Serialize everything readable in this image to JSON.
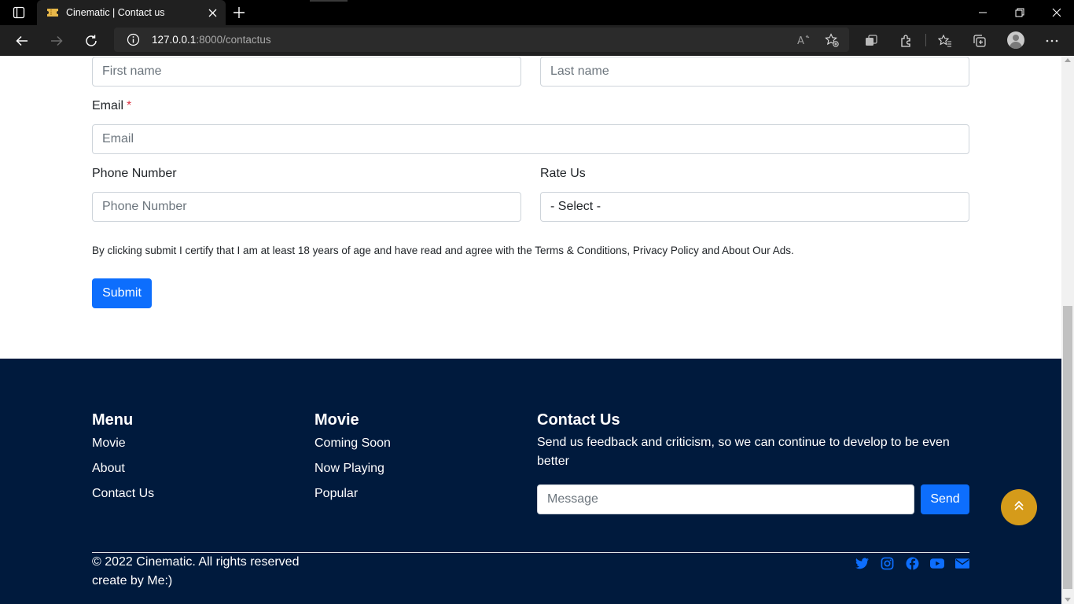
{
  "browser": {
    "tab_title": "Cinematic | Contact us",
    "url_host": "127.0.0.1",
    "url_path": ":8000/contactus"
  },
  "form": {
    "first_name_placeholder": "First name",
    "last_name_placeholder": "Last name",
    "email_label": "Email",
    "email_required_mark": "*",
    "email_placeholder": "Email",
    "phone_label": "Phone Number",
    "phone_placeholder": "Phone Number",
    "rate_label": "Rate Us",
    "rate_selected": "- Select -",
    "terms_text": "By clicking submit I certify that I am at least 18 years of age and have read and agree with the Terms & Conditions, Privacy Policy and About Our Ads.",
    "submit_label": "Submit"
  },
  "footer": {
    "menu": {
      "heading": "Menu",
      "items": [
        "Movie",
        "About",
        "Contact Us"
      ]
    },
    "movie": {
      "heading": "Movie",
      "items": [
        "Coming Soon",
        "Now Playing",
        "Popular"
      ]
    },
    "contact": {
      "heading": "Contact Us",
      "text": "Send us feedback and criticism, so we can continue to develop to be even better",
      "message_placeholder": "Message",
      "send_label": "Send"
    },
    "copyright": "© 2022 Cinematic. All rights reserved",
    "credit": "create by Me:)",
    "social_icons": [
      "twitter-icon",
      "instagram-icon",
      "facebook-icon",
      "youtube-icon",
      "mail-icon"
    ]
  },
  "colors": {
    "primary": "#0d6efd",
    "footer_bg": "#001a3d",
    "back_to_top": "#d59b1a"
  }
}
